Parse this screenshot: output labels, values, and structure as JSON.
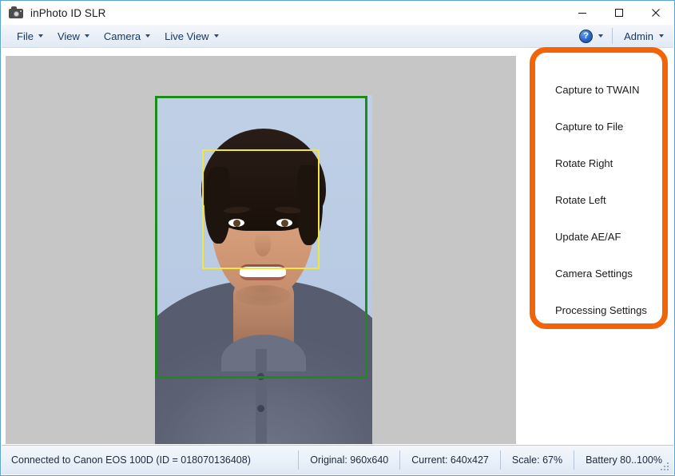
{
  "window": {
    "title": "inPhoto ID SLR",
    "app_icon": "camera-icon",
    "minimize_label": "—",
    "maximize_label": "□",
    "close_label": "✕"
  },
  "menubar": {
    "items": [
      {
        "label": "File"
      },
      {
        "label": "View"
      },
      {
        "label": "Camera"
      },
      {
        "label": "Live View"
      }
    ],
    "help": {
      "icon": "help-circle-icon",
      "glyph": "?"
    },
    "user": {
      "label": "Admin"
    }
  },
  "preview": {
    "crop_rect_color": "#1c8b1c",
    "face_rect_color": "#f2e53c",
    "background_color": "#c6c6c6"
  },
  "annotation": {
    "color": "#f26408",
    "shape": "rounded-rectangle-highlight"
  },
  "actions": {
    "items": [
      {
        "label": "Capture to TWAIN"
      },
      {
        "label": "Capture to File"
      },
      {
        "label": "Rotate Right"
      },
      {
        "label": "Rotate Left"
      },
      {
        "label": "Update AE/AF"
      },
      {
        "label": "Camera Settings"
      },
      {
        "label": "Processing Settings"
      }
    ]
  },
  "statusbar": {
    "connection": "Connected to Canon EOS 100D (ID = 018070136408)",
    "original": "Original: 960x640",
    "current": "Current: 640x427",
    "scale": "Scale: 67%",
    "battery": "Battery 80..100%"
  }
}
